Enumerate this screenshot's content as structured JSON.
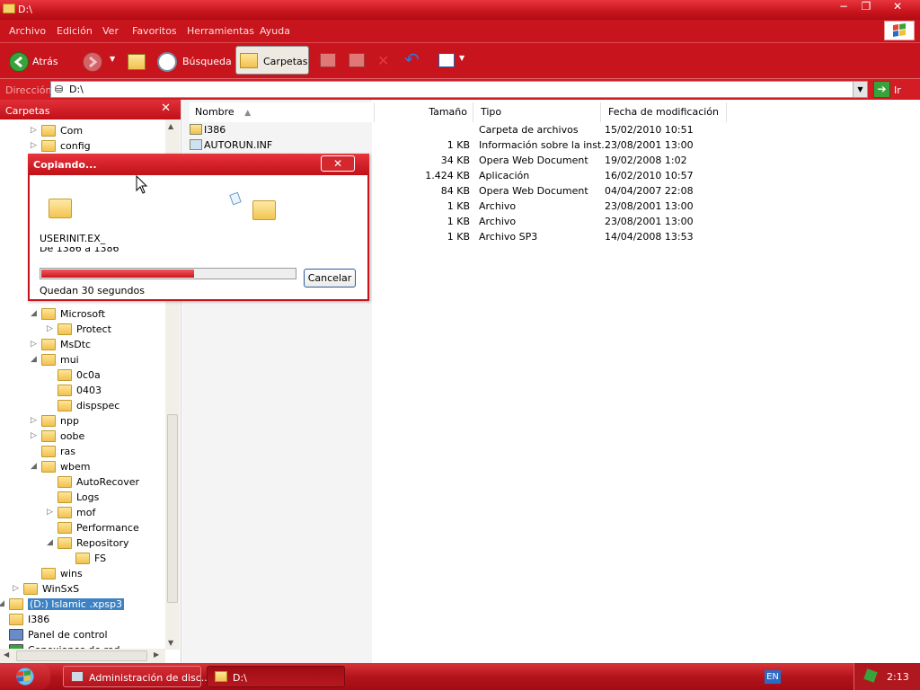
{
  "window": {
    "title": "D:\\",
    "buttons": {
      "minimize": "−",
      "restore": "❐",
      "close": "✕"
    }
  },
  "menubar": {
    "items": [
      "Archivo",
      "Edición",
      "Ver",
      "Favoritos",
      "Herramientas",
      "Ayuda"
    ]
  },
  "toolbar": {
    "back_label": "Atrás",
    "search_label": "Búsqueda",
    "folders_label": "Carpetas"
  },
  "address": {
    "label": "Dirección",
    "value": "D:\\",
    "go_label": "Ir"
  },
  "folders_pane": {
    "title": "Carpetas",
    "close": "✕",
    "items": [
      {
        "label": "Com",
        "expander": "▷"
      },
      {
        "label": "config",
        "expander": "▷"
      },
      {
        "label": "Microsoft",
        "expander": "◢"
      },
      {
        "label": "Protect",
        "expander": "▷"
      },
      {
        "label": "MsDtc",
        "expander": "▷"
      },
      {
        "label": "mui",
        "expander": "◢"
      },
      {
        "label": "0c0a",
        "expander": ""
      },
      {
        "label": "0403",
        "expander": ""
      },
      {
        "label": "dispspec",
        "expander": ""
      },
      {
        "label": "npp",
        "expander": "▷"
      },
      {
        "label": "oobe",
        "expander": "▷"
      },
      {
        "label": "ras",
        "expander": ""
      },
      {
        "label": "wbem",
        "expander": "◢"
      },
      {
        "label": "AutoRecover",
        "expander": ""
      },
      {
        "label": "Logs",
        "expander": ""
      },
      {
        "label": "mof",
        "expander": "▷"
      },
      {
        "label": "Performance",
        "expander": ""
      },
      {
        "label": "Repository",
        "expander": "◢"
      },
      {
        "label": "FS",
        "expander": ""
      },
      {
        "label": "wins",
        "expander": ""
      },
      {
        "label": "WinSxS",
        "expander": "▷"
      },
      {
        "label": "(D:) Islamic .xpsp3",
        "expander": "◢"
      },
      {
        "label": "I386",
        "expander": ""
      },
      {
        "label": "Panel de control",
        "expander": ""
      },
      {
        "label": "Conexiones de red",
        "expander": ""
      }
    ]
  },
  "file_list": {
    "columns": [
      "Nombre",
      "Tamaño",
      "Tipo",
      "Fecha de modificación"
    ],
    "rows": [
      {
        "name": "I386",
        "size": "",
        "type": "Carpeta de archivos",
        "date": "15/02/2010 10:51"
      },
      {
        "name": "AUTORUN.INF",
        "size": "1 KB",
        "type": "Información sobre la inst...",
        "date": "23/08/2001 13:00"
      },
      {
        "name": "",
        "size": "34 KB",
        "type": "Opera Web Document",
        "date": "19/02/2008 1:02"
      },
      {
        "name": "",
        "size": "1.424 KB",
        "type": "Aplicación",
        "date": "16/02/2010 10:57"
      },
      {
        "name": "",
        "size": "84 KB",
        "type": "Opera Web Document",
        "date": "04/04/2007 22:08"
      },
      {
        "name": "",
        "size": "1 KB",
        "type": "Archivo",
        "date": "23/08/2001 13:00"
      },
      {
        "name": "",
        "size": "1 KB",
        "type": "Archivo",
        "date": "23/08/2001 13:00"
      },
      {
        "name": "",
        "size": "1 KB",
        "type": "Archivo SP3",
        "date": "14/04/2008 13:53"
      }
    ]
  },
  "copy_dialog": {
    "title": "Copiando...",
    "close": "✕",
    "filename": "USERINIT.EX_",
    "from_to": "De 1386 a 1386",
    "time_left": "Quedan 30 segundos",
    "progress": 0.6,
    "cancel_label": "Cancelar"
  },
  "taskbar": {
    "tasks": [
      {
        "label": "Administración de disc..."
      },
      {
        "label": "D:\\"
      }
    ],
    "language": "EN",
    "clock": "2:13"
  }
}
